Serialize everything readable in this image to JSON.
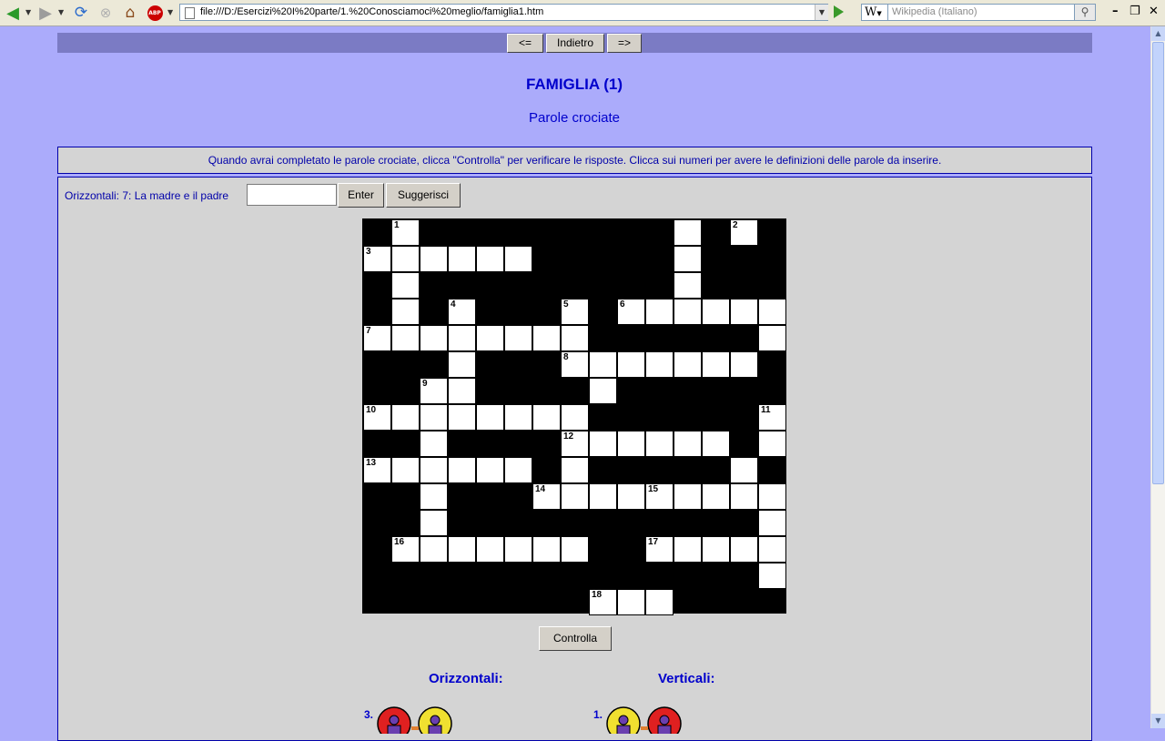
{
  "browser": {
    "url": "file:///D:/Esercizi%20I%20parte/1.%20Conosciamoci%20meglio/famiglia1.htm",
    "search_engine_label": "W",
    "search_placeholder": "Wikipedia (Italiano)"
  },
  "nav": {
    "prev": "<=",
    "back": "Indietro",
    "next": "=>"
  },
  "page": {
    "title": "FAMIGLIA (1)",
    "subtitle": "Parole crociate",
    "instructions": "Quando avrai completato le parole crociate, clicca \"Controlla\" per verificare le risposte. Clicca sui numeri per avere le definizioni delle parole da inserire."
  },
  "clue": {
    "text": "Orizzontali: 7: La madre e il padre",
    "answer_value": "",
    "enter_label": "Enter",
    "hint_label": "Suggerisci"
  },
  "check_label": "Controlla",
  "lists": {
    "across_heading": "Orizzontali:",
    "down_heading": "Verticali:",
    "across_first_num": "3.",
    "down_first_num": "1."
  },
  "colors": {
    "page_bg": "#ababfb",
    "nav_bar": "#7b7bc4",
    "text_blue": "#0000cc",
    "panel_bg": "#d4d4d4"
  },
  "crossword": {
    "rows": [
      "#.#########.#",
      "......#####.#",
      "#.#########.#",
      "#.#.###.#.......",
      "........######.#",
      "###.###.......#",
      "###.####.#####",
      "........######.",
      "##.####......#.",
      "......#.#####.",
      "##.###.........",
      "##.###########.#.",
      "#.......##......",
      "##############.###",
      "########...#####"
    ],
    "numbers": [
      {
        "n": "1",
        "r": 0,
        "c": 1
      },
      {
        "n": "2",
        "r": 0,
        "c": 13
      },
      {
        "n": "3",
        "r": 1,
        "c": 0
      },
      {
        "n": "4",
        "r": 3,
        "c": 3
      },
      {
        "n": "5",
        "r": 3,
        "c": 7
      },
      {
        "n": "6",
        "r": 3,
        "c": 9
      },
      {
        "n": "7",
        "r": 4,
        "c": 0
      },
      {
        "n": "8",
        "r": 5,
        "c": 7
      },
      {
        "n": "9",
        "r": 6,
        "c": 2
      },
      {
        "n": "10",
        "r": 7,
        "c": 0
      },
      {
        "n": "11",
        "r": 7,
        "c": 14
      },
      {
        "n": "12",
        "r": 8,
        "c": 7
      },
      {
        "n": "13",
        "r": 9,
        "c": 0
      },
      {
        "n": "14",
        "r": 10,
        "c": 6
      },
      {
        "n": "15",
        "r": 10,
        "c": 10
      },
      {
        "n": "16",
        "r": 12,
        "c": 1
      },
      {
        "n": "17",
        "r": 12,
        "c": 10
      },
      {
        "n": "18",
        "r": 14,
        "c": 8
      }
    ]
  }
}
